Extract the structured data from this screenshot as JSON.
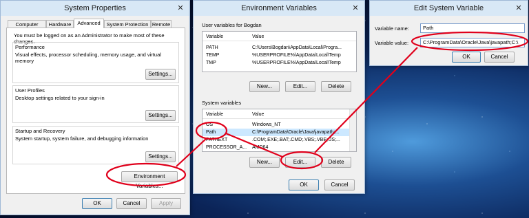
{
  "sysprops": {
    "title": "System Properties",
    "tabs": [
      "Computer Name",
      "Hardware",
      "Advanced",
      "System Protection",
      "Remote"
    ],
    "admin_note": "You must be logged on as an Administrator to make most of these changes.",
    "performance": {
      "label": "Performance",
      "desc": "Visual effects, processor scheduling, memory usage, and virtual memory",
      "button": "Settings..."
    },
    "profiles": {
      "label": "User Profiles",
      "desc": "Desktop settings related to your sign-in",
      "button": "Settings..."
    },
    "startup": {
      "label": "Startup and Recovery",
      "desc": "System startup, system failure, and debugging information",
      "button": "Settings..."
    },
    "env_button": "Environment Variables...",
    "ok": "OK",
    "cancel": "Cancel",
    "apply": "Apply"
  },
  "envvars": {
    "title": "Environment Variables",
    "user_label": "User variables for Bogdan",
    "columns": [
      "Variable",
      "Value"
    ],
    "user_rows": [
      [
        "PATH",
        "C:\\Users\\Bogdan\\AppData\\Local\\Progra..."
      ],
      [
        "TEMP",
        "%USERPROFILE%\\AppData\\Local\\Temp"
      ],
      [
        "TMP",
        "%USERPROFILE%\\AppData\\Local\\Temp"
      ]
    ],
    "system_label": "System variables",
    "system_rows": [
      [
        "OS",
        "Windows_NT"
      ],
      [
        "Path",
        "C:\\ProgramData\\Oracle\\Java\\javapath;..."
      ],
      [
        "PATHEXT",
        ".COM;.EXE;.BAT;.CMD;.VBS;.VBE;.JS;..."
      ],
      [
        "PROCESSOR_A...",
        "AMD64"
      ]
    ],
    "new": "New...",
    "edit": "Edit...",
    "delete": "Delete",
    "ok": "OK",
    "cancel": "Cancel"
  },
  "editvar": {
    "title": "Edit System Variable",
    "name_label": "Variable name:",
    "name_value": "Path",
    "value_label": "Variable value:",
    "value_value": "C:\\ProgramData\\Oracle\\Java\\javapath;C:\\",
    "ok": "OK",
    "cancel": "Cancel"
  },
  "colors": {
    "highlight": "#e0001b",
    "titlebar": "#d8e8f6",
    "selection": "#cce8ff"
  }
}
